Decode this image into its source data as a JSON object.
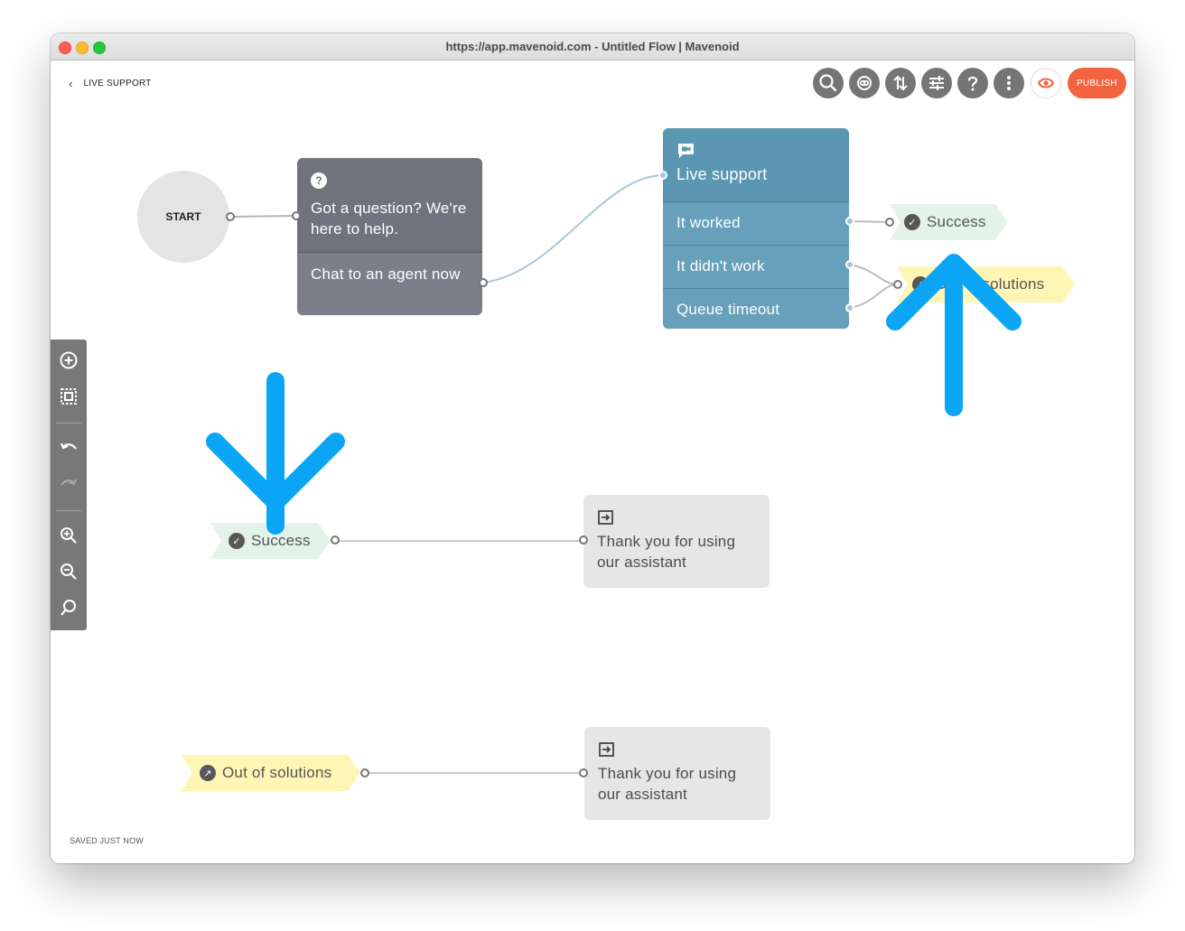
{
  "window": {
    "title": "https://app.mavenoid.com - Untitled Flow | Mavenoid"
  },
  "header": {
    "back_label": "LIVE SUPPORT",
    "publish_label": "PUBLISH",
    "tools": [
      "search-icon",
      "chat-bot-icon",
      "sort-arrows-icon",
      "sliders-icon",
      "help-icon",
      "more-vertical-icon",
      "eye-icon"
    ]
  },
  "footer": {
    "status": "SAVED JUST NOW"
  },
  "left_toolbar": {
    "tools": [
      "add-node-icon",
      "select-area-icon",
      "undo-icon",
      "redo-icon",
      "zoom-in-icon",
      "zoom-out-icon",
      "zoom-fit-icon"
    ]
  },
  "flow": {
    "start": {
      "label": "START"
    },
    "question_node": {
      "icon": "?",
      "text": "Got a question? We're here to help.",
      "option": "Chat to an agent now"
    },
    "live_support_node": {
      "title": "Live support",
      "options": [
        "It worked",
        "It didn't work",
        "Queue timeout"
      ]
    },
    "outcome_success_top": {
      "label": "Success"
    },
    "outcome_out_top": {
      "label": "Out of solutions"
    },
    "success_entry": {
      "label": "Success"
    },
    "success_end": {
      "text": "Thank you for using our assistant"
    },
    "out_entry": {
      "label": "Out of solutions"
    },
    "out_end": {
      "text": "Thank you for using our assistant"
    }
  },
  "annotations": {
    "color": "#0aa5f5",
    "arrows": [
      "down-arrow",
      "up-arrow"
    ]
  }
}
